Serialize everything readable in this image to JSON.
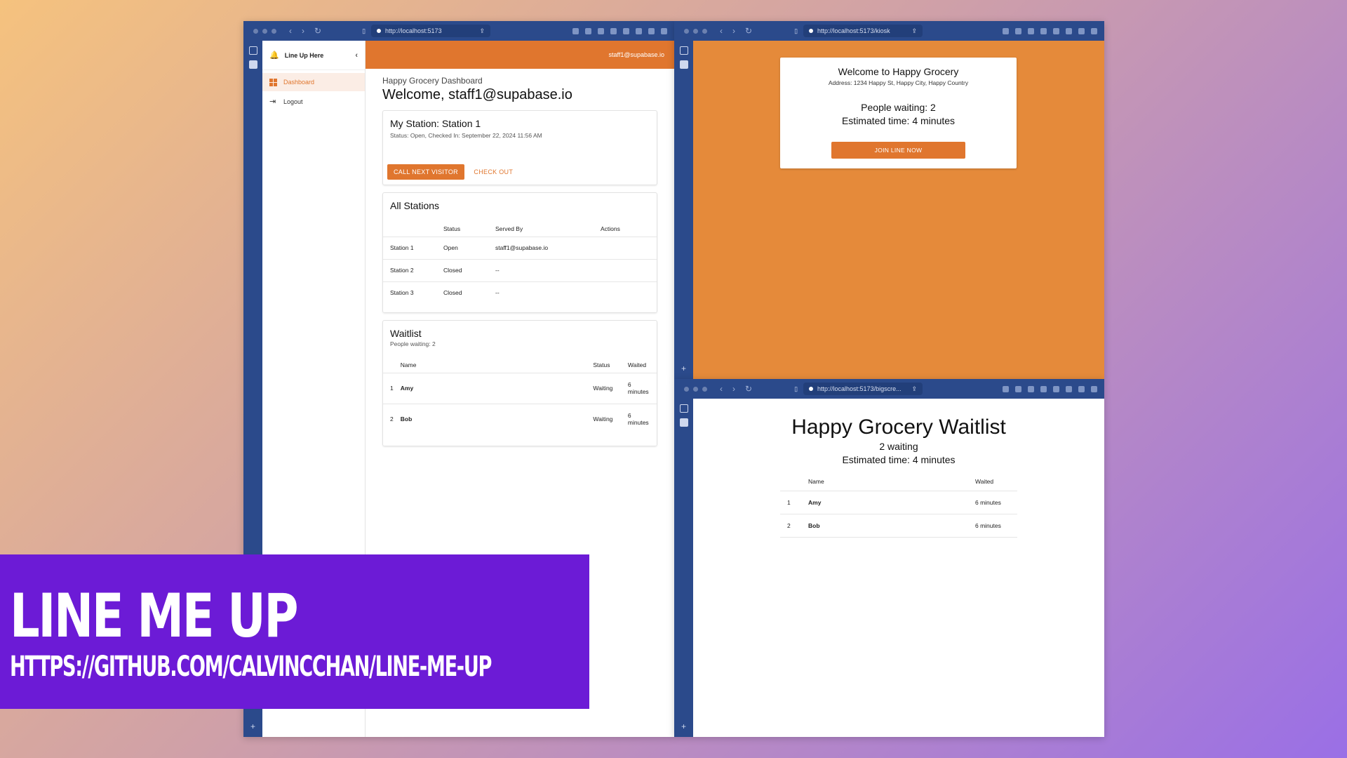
{
  "dashboard_window": {
    "url": "http://localhost:5173",
    "app_title": "Line Up Here",
    "nav": [
      {
        "label": "Dashboard"
      },
      {
        "label": "Logout"
      }
    ],
    "user_email": "staff1@supabase.io",
    "page_subtitle": "Happy Grocery Dashboard",
    "page_title": "Welcome, staff1@supabase.io",
    "station_card": {
      "title": "My Station: Station 1",
      "status": "Status: Open, Checked In: September 22, 2024 11:56 AM",
      "call_next_label": "CALL NEXT VISITOR",
      "check_out_label": "CHECK OUT"
    },
    "all_stations": {
      "title": "All Stations",
      "headers": [
        "",
        "Status",
        "Served By",
        "Actions"
      ],
      "rows": [
        [
          "Station 1",
          "Open",
          "staff1@supabase.io",
          ""
        ],
        [
          "Station 2",
          "Closed",
          "--",
          ""
        ],
        [
          "Station 3",
          "Closed",
          "--",
          ""
        ]
      ]
    },
    "waitlist": {
      "title": "Waitlist",
      "subtitle": "People waiting: 2",
      "headers": [
        "",
        "Name",
        "Status",
        "Waited"
      ],
      "rows": [
        [
          "1",
          "Amy",
          "Waiting",
          "6 minutes"
        ],
        [
          "2",
          "Bob",
          "Waiting",
          "6 minutes"
        ]
      ]
    }
  },
  "kiosk_window": {
    "url": "http://localhost:5173/kiosk",
    "welcome": "Welcome to Happy Grocery",
    "address": "Address: 1234 Happy St, Happy City, Happy Country",
    "people_waiting": "People waiting: 2",
    "estimated_time": "Estimated time: 4 minutes",
    "join_label": "JOIN LINE NOW",
    "bg_color": "#e58a3a"
  },
  "bigscreen_window": {
    "url": "http://localhost:5173/bigscre...",
    "title": "Happy Grocery Waitlist",
    "waiting": "2 waiting",
    "estimated_time": "Estimated time: 4 minutes",
    "headers": [
      "",
      "Name",
      "Waited"
    ],
    "rows": [
      [
        "1",
        "Amy",
        "6 minutes"
      ],
      [
        "2",
        "Bob",
        "6 minutes"
      ]
    ]
  },
  "overlay": {
    "title": "LINE ME UP",
    "url": "HTTPS://GITHUB.COM/CALVINCCHAN/LINE-ME-UP"
  },
  "colors": {
    "accent": "#e0762e",
    "browser_chrome": "#2b4a8b",
    "overlay_bg": "#6c1bd6"
  }
}
